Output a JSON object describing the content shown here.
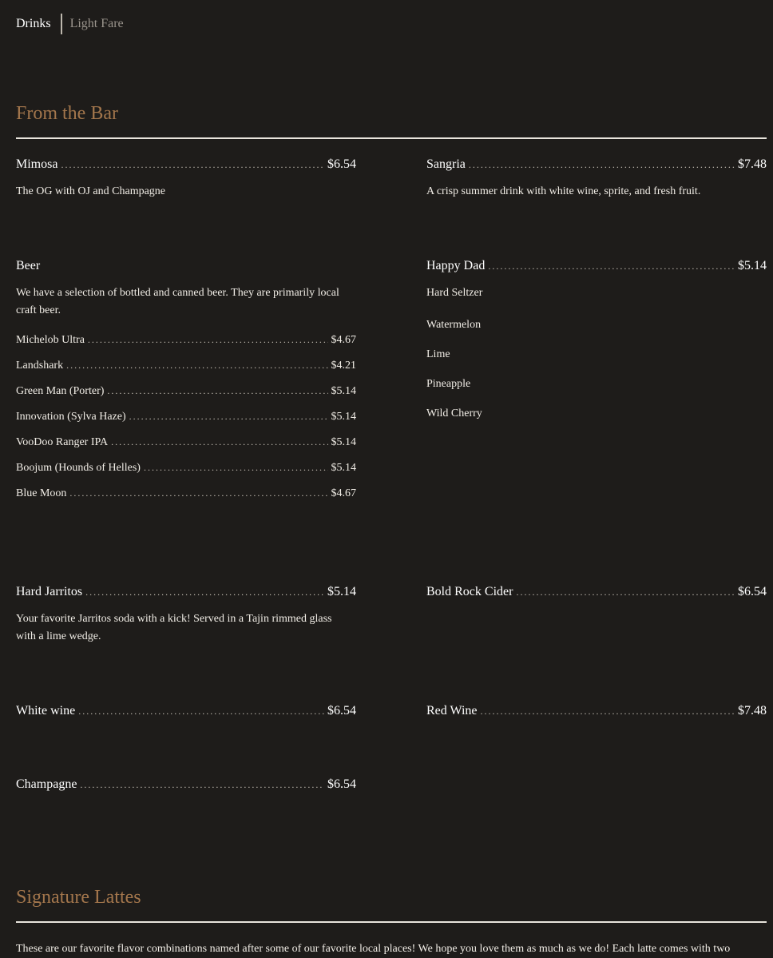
{
  "tabs": [
    {
      "label": "Drinks",
      "active": true
    },
    {
      "label": "Light Fare",
      "active": false
    }
  ],
  "sections": {
    "bar": {
      "title": "From the Bar"
    },
    "lattes": {
      "title": "Signature Lattes",
      "description": "These are our favorite flavor combinations named after some of our favorite local places! We hope you love them as much as we do! Each latte comes with two"
    }
  },
  "items": {
    "mimosa": {
      "name": "Mimosa",
      "price": "$6.54",
      "desc": "The OG with OJ and Champagne"
    },
    "sangria": {
      "name": "Sangria",
      "price": "$7.48",
      "desc": "A crisp summer drink with white wine, sprite, and fresh fruit."
    },
    "beer": {
      "name": "Beer",
      "desc": "We have a selection of bottled and canned beer. They are primarily local craft beer.",
      "list": [
        {
          "name": "Michelob Ultra",
          "price": "$4.67"
        },
        {
          "name": "Landshark",
          "price": "$4.21"
        },
        {
          "name": "Green Man (Porter)",
          "price": "$5.14"
        },
        {
          "name": "Innovation (Sylva Haze)",
          "price": "$5.14"
        },
        {
          "name": "VooDoo Ranger IPA",
          "price": "$5.14"
        },
        {
          "name": "Boojum (Hounds of Helles)",
          "price": "$5.14"
        },
        {
          "name": "Blue Moon",
          "price": "$4.67"
        }
      ]
    },
    "happy_dad": {
      "name": "Happy Dad",
      "price": "$5.14",
      "flavors": [
        "Hard Seltzer",
        "Watermelon",
        "Lime",
        "Pineapple",
        "Wild Cherry"
      ]
    },
    "hard_jarritos": {
      "name": "Hard Jarritos",
      "price": "$5.14",
      "desc": "Your favorite Jarritos soda with a kick! Served in a Tajin rimmed glass with a lime wedge."
    },
    "bold_rock": {
      "name": "Bold Rock Cider",
      "price": "$6.54"
    },
    "white_wine": {
      "name": "White wine",
      "price": "$6.54"
    },
    "red_wine": {
      "name": "Red Wine",
      "price": "$7.48"
    },
    "champagne": {
      "name": "Champagne",
      "price": "$6.54"
    }
  }
}
